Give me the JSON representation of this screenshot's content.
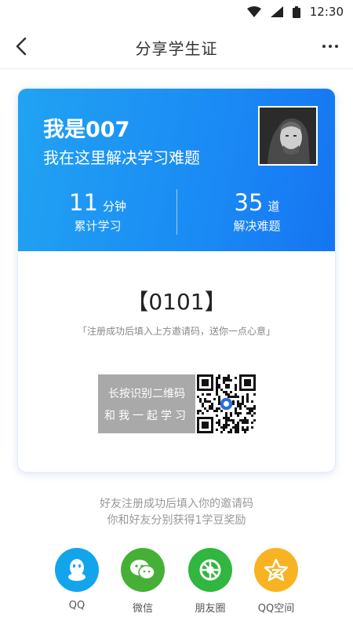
{
  "status_bar": {
    "time": "12:30"
  },
  "header": {
    "title": "分享学生证"
  },
  "card": {
    "name": "我是007",
    "slogan": "我在这里解决学习难题",
    "stats": [
      {
        "number": "11",
        "unit": "分钟",
        "label": "累计学习"
      },
      {
        "number": "35",
        "unit": "道",
        "label": "解决难题"
      }
    ],
    "invite_code": "【0101】",
    "invite_hint": "「注册成功后填入上方邀请码，送你一点心意」",
    "qr_label_line1": "长按识别二维码",
    "qr_label_line2": "和我一起学习"
  },
  "share_tip": {
    "line1": "好友注册成功后填入你的邀请码",
    "line2": "你和好友分别获得1学豆奖励"
  },
  "share_options": [
    {
      "label": "QQ",
      "icon": "qq-icon",
      "color": "#12a5ec"
    },
    {
      "label": "微信",
      "icon": "wechat-icon",
      "color": "#45b035"
    },
    {
      "label": "朋友圈",
      "icon": "moments-icon",
      "color": "#31b63f"
    },
    {
      "label": "QQ空间",
      "icon": "qzone-icon",
      "color": "#f8b323"
    }
  ]
}
